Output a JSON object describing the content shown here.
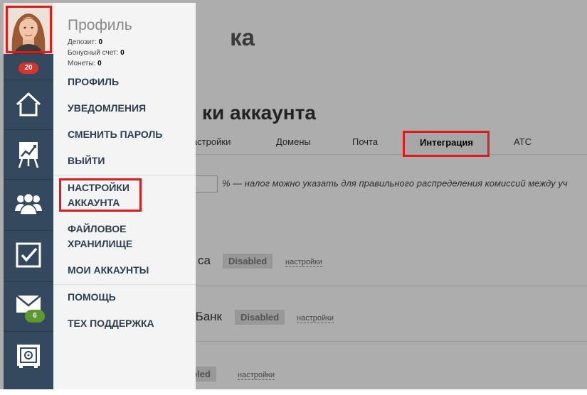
{
  "background": {
    "page_title_fragment": "ка",
    "section_title_fragment": "ки аккаунта",
    "tabs": [
      {
        "label": "астройки"
      },
      {
        "label": "Домены"
      },
      {
        "label": "Почта"
      },
      {
        "label": "Интеграция",
        "active": true
      },
      {
        "label": "АТС"
      }
    ],
    "tax_note": "% — налог можно указать для правильного распределения комиссий между уч",
    "integrations": [
      {
        "name": "са",
        "status": "Disabled",
        "link": "настройки"
      },
      {
        "name": "Банк",
        "status": "Disabled",
        "link": "настройки"
      },
      {
        "name": "",
        "status": "abled",
        "link": "настройки"
      }
    ]
  },
  "sidebar": {
    "notification_count": "20",
    "mail_count": "6",
    "icons": [
      "home-icon",
      "chart-icon",
      "team-icon",
      "tasks-icon",
      "mail-icon",
      "safe-icon"
    ]
  },
  "profile_menu": {
    "title": "Профиль",
    "stats": [
      {
        "label": "Депозит:",
        "value": "0"
      },
      {
        "label": "Бонусный счет:",
        "value": "0"
      },
      {
        "label": "Монеты:",
        "value": "0"
      }
    ],
    "items": [
      {
        "label": "ПРОФИЛЬ"
      },
      {
        "label": "УВЕДОМЛЕНИЯ"
      },
      {
        "label": "СМЕНИТЬ ПАРОЛЬ"
      },
      {
        "label": "ВЫЙТИ"
      },
      {
        "label": "НАСТРОЙКИ\nАККАУНТА"
      },
      {
        "label": "ФАЙЛОВОЕ\nХРАНИЛИЩЕ"
      },
      {
        "label": "МОИ АККАУНТЫ"
      },
      {
        "label": "ПОМОЩЬ"
      },
      {
        "label": "ТЕХ ПОДДЕРЖКА"
      }
    ]
  },
  "colors": {
    "sidebar_bg": "#34495e",
    "highlight": "#e01b1b",
    "menu_text": "#2c3e50"
  }
}
